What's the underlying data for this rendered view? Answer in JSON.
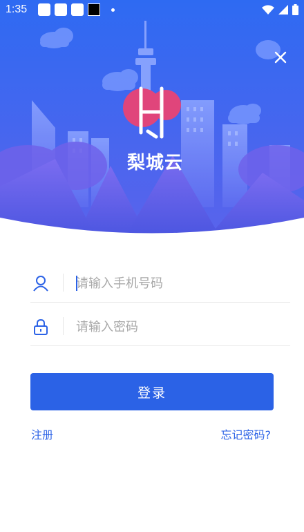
{
  "status_bar": {
    "time": "1:35"
  },
  "brand": {
    "name": "梨城云",
    "logo_letter": "H"
  },
  "login_form": {
    "phone_placeholder": "请输入手机号码",
    "password_placeholder": "请输入密码",
    "login_label": "登录",
    "register_label": "注册",
    "forgot_label": "忘记密码?"
  },
  "icons": {
    "close": "close-icon",
    "user": "user-icon",
    "lock": "lock-icon",
    "wifi": "wifi-icon",
    "signal": "signal-icon",
    "battery": "battery-icon"
  },
  "colors": {
    "primary": "#2b62e6",
    "hero_top": "#2f5ff0",
    "hero_bottom": "#6a5ce8",
    "logo_accent": "#e0457b",
    "placeholder": "#a8a8a8"
  }
}
